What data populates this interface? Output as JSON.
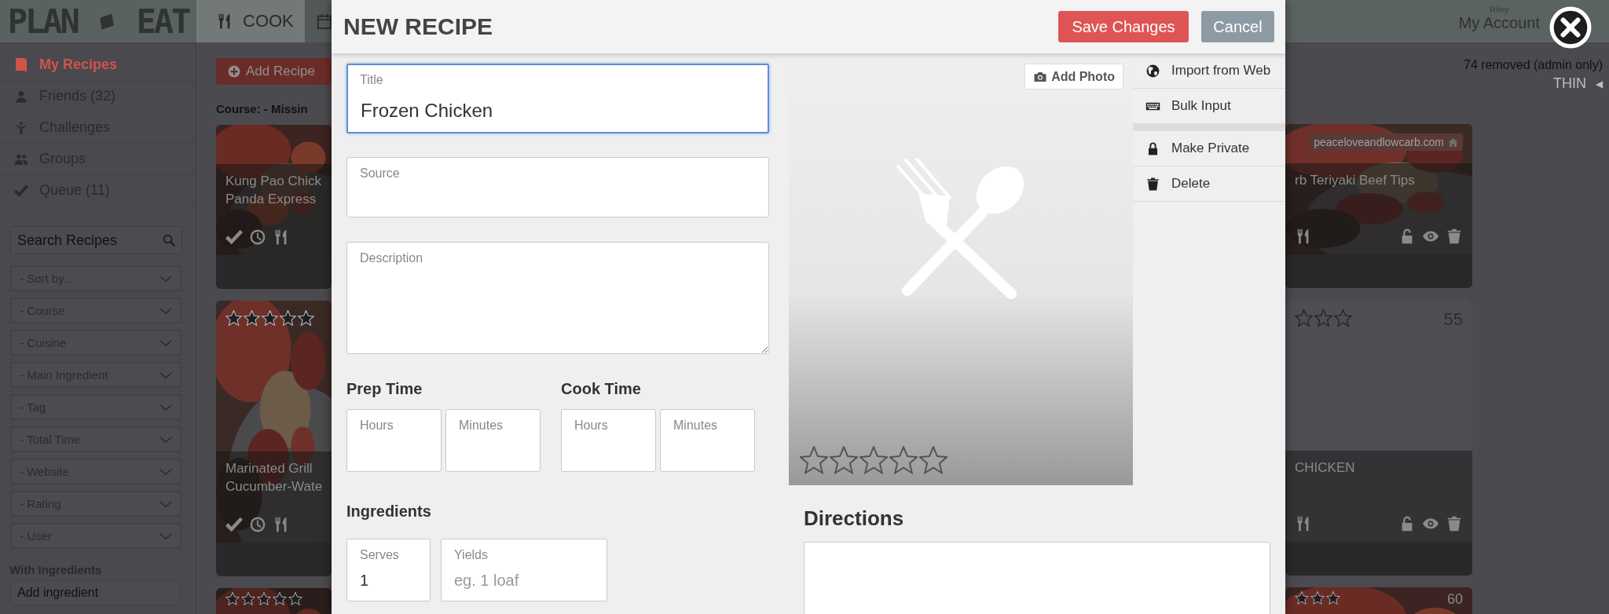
{
  "topbar": {
    "logo": {
      "left": "PLAN",
      "right": "EAT"
    },
    "tabs": [
      {
        "label": "COOK",
        "selected": true
      },
      {
        "selected": false
      }
    ],
    "account": {
      "user": "Riley",
      "link": "My Account"
    }
  },
  "sidebar": {
    "items": [
      {
        "label": "My Recipes",
        "selected": true
      },
      {
        "label": "Friends (32)",
        "selected": false
      },
      {
        "label": "Challenges",
        "selected": false
      },
      {
        "label": "Groups",
        "selected": false
      },
      {
        "label": "Queue (11)",
        "selected": false
      }
    ],
    "search": {
      "placeholder": "Search Recipes"
    },
    "filters": [
      "- Sort by...",
      "- Course",
      "- Cuisine",
      "- Main Ingredient",
      "- Tag",
      "- Total Time",
      "- Website",
      "- Rating",
      "- User"
    ],
    "ingredients": {
      "heading": "With Ingredients",
      "placeholder": "Add ingredient"
    }
  },
  "main": {
    "add_button": "Add Recipe",
    "course_filter": "Course: **- Missin**",
    "cards_left": [
      {
        "title_lines": [
          "Kung Pao Chick",
          "Panda Express"
        ]
      },
      {
        "stars": 0,
        "title_lines": [
          "Marinated Grill",
          "Cucumber-Wate"
        ]
      },
      {
        "kind": "picture",
        "stars": 0
      }
    ],
    "cards_right": [
      {
        "source": "peaceloveandlowcarb.com",
        "title_lines": [
          "rb Teriyaki Beef Tips"
        ]
      },
      {
        "kind": "plain",
        "stars": 0,
        "count": "55",
        "title_lines": [
          "CHICKEN"
        ]
      },
      {
        "stars": 0,
        "count": "60"
      }
    ],
    "removed_note": "74 removed (admin only)",
    "view_toggle": {
      "label": "THIN",
      "arrow": "◀"
    }
  },
  "modal": {
    "title": "NEW RECIPE",
    "buttons": [
      {
        "label": "Save Changes",
        "kind": "primary"
      },
      {
        "label": "Cancel",
        "kind": "secondary"
      }
    ],
    "fields": [
      {
        "kind": "input",
        "label": "Title",
        "value": "Frozen Chicken",
        "focused": true
      },
      {
        "kind": "input",
        "label": "Source",
        "focused": false
      },
      {
        "kind": "textarea",
        "label": "Description",
        "focused": false
      }
    ],
    "prep_time": {
      "heading": "Prep Time",
      "fields": [
        {
          "label": "Hours"
        },
        {
          "label": "Minutes"
        }
      ]
    },
    "cook_time": {
      "heading": "Cook Time",
      "fields": [
        {
          "label": "Hours"
        },
        {
          "label": "Minutes"
        }
      ]
    },
    "ingredients": {
      "heading": "Ingredients",
      "fields": [
        {
          "label": "Serves",
          "value": "1"
        },
        {
          "label": "Yields",
          "placeholder": "eg. 1 loaf"
        }
      ]
    },
    "photo": {
      "button": "Add Photo",
      "stars": 0
    },
    "menu_groups": [
      [
        {
          "label": "Import from Web"
        },
        {
          "label": "Bulk Input"
        }
      ],
      [
        {
          "label": "Make Private"
        },
        {
          "label": "Delete"
        }
      ]
    ],
    "directions": {
      "heading": "Directions"
    }
  }
}
